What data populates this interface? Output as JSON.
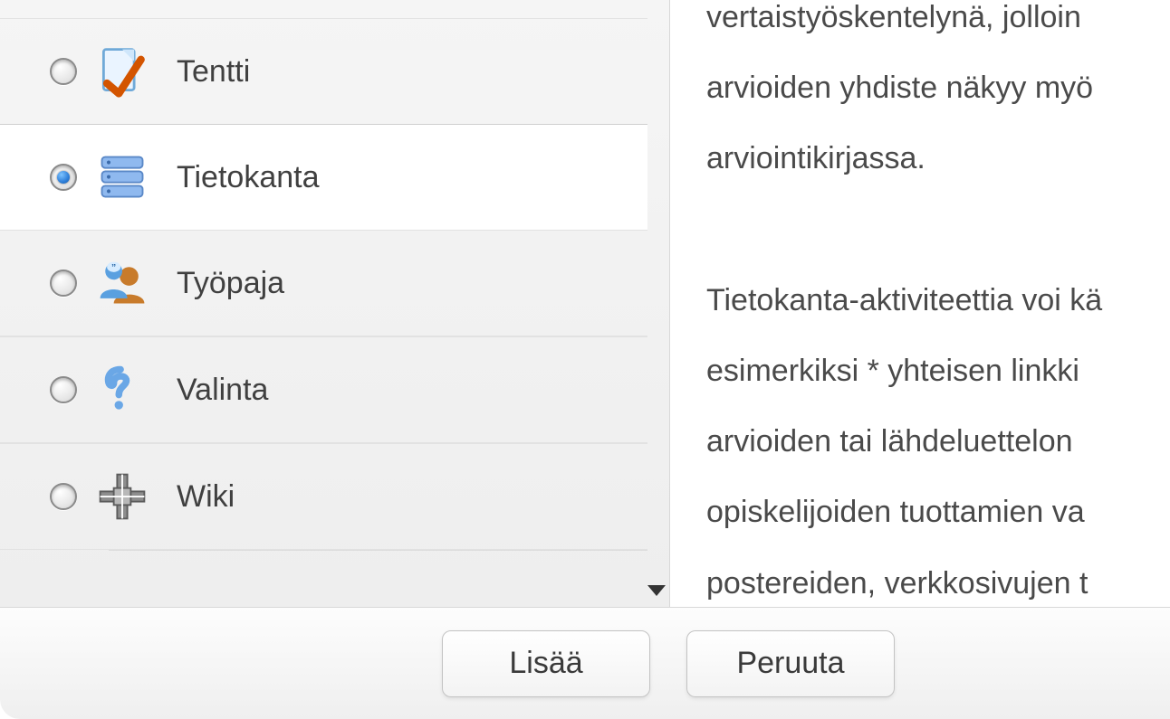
{
  "activities": [
    {
      "id": "tentti",
      "label": "Tentti",
      "selected": false
    },
    {
      "id": "tietokanta",
      "label": "Tietokanta",
      "selected": true
    },
    {
      "id": "tyopaja",
      "label": "Työpaja",
      "selected": false
    },
    {
      "id": "valinta",
      "label": "Valinta",
      "selected": false
    },
    {
      "id": "wiki",
      "label": "Wiki",
      "selected": false
    }
  ],
  "description": "vertaistyöskentelynä, jolloin\narvioiden yhdiste näkyy myö\narviointikirjassa.\n\nTietokanta-aktiviteettia voi kä\nesimerkiksi * yhteisen linkki\narvioiden tai lähdeluettelon\nopiskelijoiden tuottamien va\npostereiden, verkkosivujen t\nvertaiskommentointiin ja -ar",
  "buttons": {
    "add": "Lisää",
    "cancel": "Peruuta"
  }
}
